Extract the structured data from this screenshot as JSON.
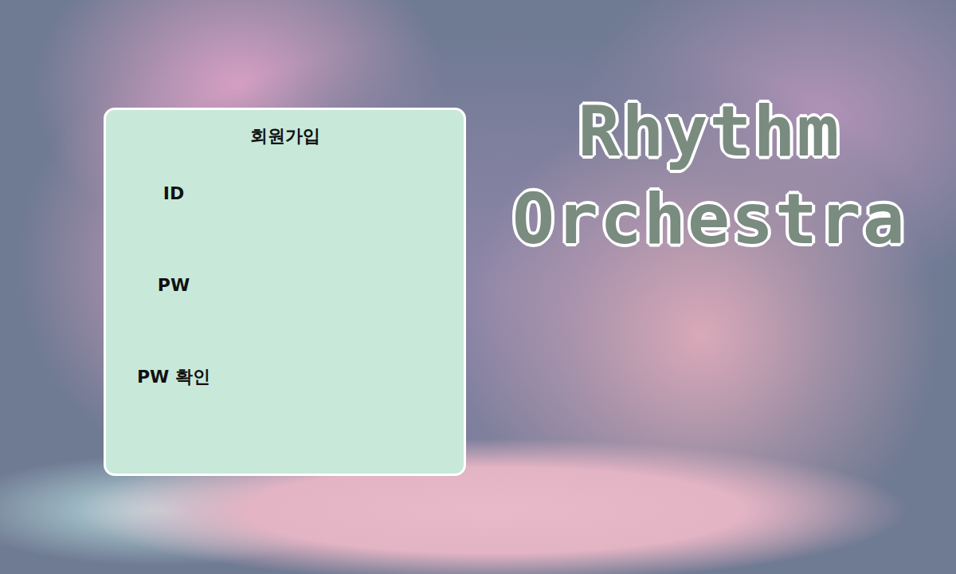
{
  "form": {
    "title": "회원가입",
    "fields": [
      {
        "label": "ID"
      },
      {
        "label": "PW"
      },
      {
        "label": "PW 확인"
      }
    ]
  },
  "logo": {
    "lines": [
      "Rhythm",
      "Orchestra"
    ]
  }
}
